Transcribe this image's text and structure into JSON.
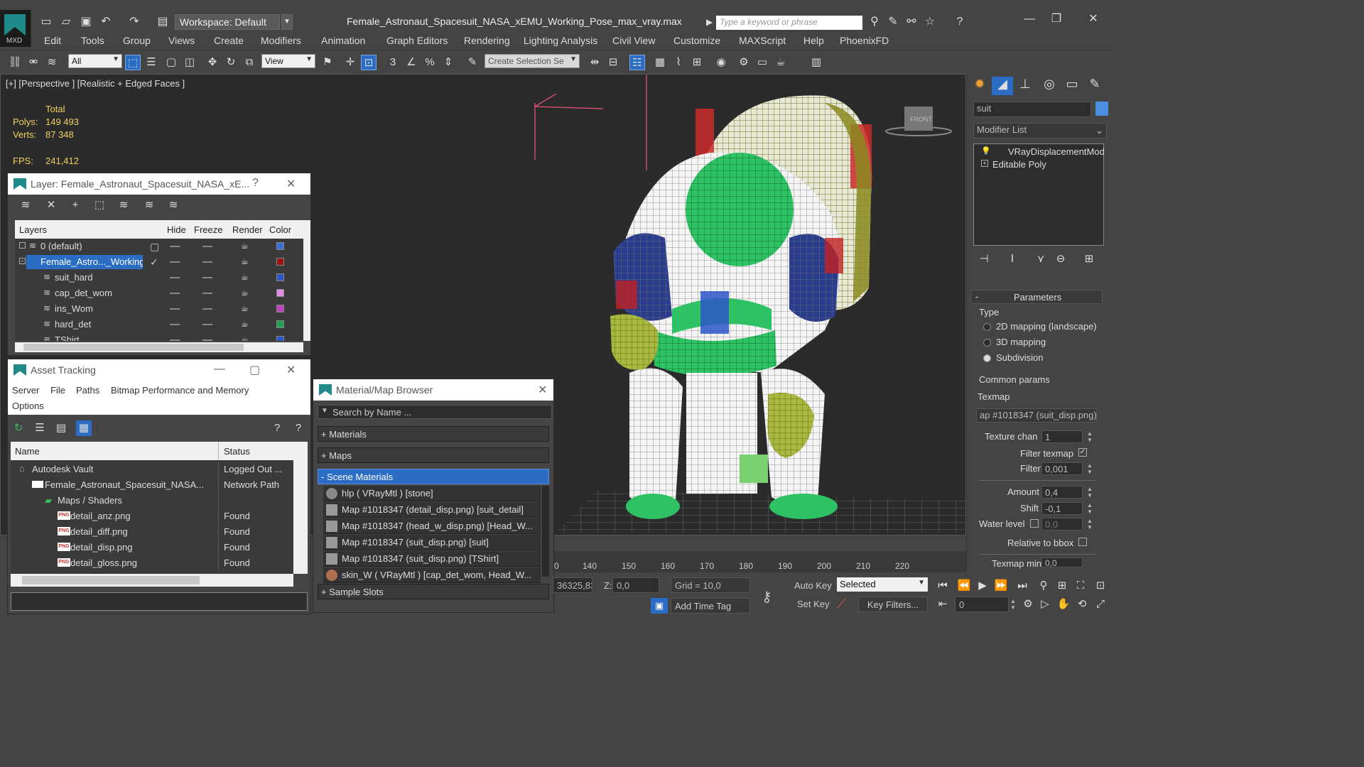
{
  "app": {
    "logo_text": "MXD",
    "workspace_label": "Workspace: Default",
    "doc_title": "Female_Astronaut_Spacesuit_NASA_xEMU_Working_Pose_max_vray.max",
    "search_placeholder": "Type a keyword or phrase"
  },
  "menu": [
    "Edit",
    "Tools",
    "Group",
    "Views",
    "Create",
    "Modifiers",
    "Animation",
    "Graph Editors",
    "Rendering",
    "Lighting Analysis",
    "Civil View",
    "Customize",
    "MAXScript",
    "Help",
    "PhoenixFD"
  ],
  "toolbar": {
    "filter_value": "All",
    "refcoord_value": "View",
    "selection_set_placeholder": "Create Selection Se"
  },
  "viewport": {
    "label": "[+] [Perspective ] [Realistic + Edged Faces ]",
    "stats_header": "Total",
    "polys_label": "Polys:",
    "polys_value": "149 493",
    "verts_label": "Verts:",
    "verts_value": "87 348",
    "fps_label": "FPS:",
    "fps_value": "241,412",
    "viewcube_label": "FRONT"
  },
  "layer_window": {
    "title": "Layer: Female_Astronaut_Spacesuit_NASA_xE...",
    "help": "?",
    "columns": [
      "Layers",
      "Hide",
      "Freeze",
      "Render",
      "Color"
    ],
    "rows": [
      {
        "name": "0 (default)",
        "color": "#3a6fd8",
        "checked": false,
        "selected": false,
        "indent": 0
      },
      {
        "name": "Female_Astro..._Working",
        "color": "#9b1010",
        "checked": true,
        "selected": true,
        "indent": 0
      },
      {
        "name": "suit_hard",
        "color": "#2a56c8",
        "checked": false,
        "selected": false,
        "indent": 1
      },
      {
        "name": "cap_det_wom",
        "color": "#e48be4",
        "checked": false,
        "selected": false,
        "indent": 1
      },
      {
        "name": "ins_Wom",
        "color": "#c040c0",
        "checked": false,
        "selected": false,
        "indent": 1
      },
      {
        "name": "hard_det",
        "color": "#1fa050",
        "checked": false,
        "selected": false,
        "indent": 1
      },
      {
        "name": "TShirt",
        "color": "#2a56c8",
        "checked": false,
        "selected": false,
        "indent": 1
      }
    ]
  },
  "asset_window": {
    "title": "Asset Tracking",
    "menu": [
      "Server",
      "File",
      "Paths",
      "Bitmap Performance and Memory",
      "Options"
    ],
    "col_name": "Name",
    "col_status": "Status",
    "rows": [
      {
        "name": "Autodesk Vault",
        "status": "Logged Out ...",
        "indent": 1,
        "icon": "vault"
      },
      {
        "name": "Female_Astronaut_Spacesuit_NASA...",
        "status": "Network Path",
        "indent": 2,
        "icon": "file"
      },
      {
        "name": "Maps / Shaders",
        "status": "",
        "indent": 3,
        "icon": "folder"
      },
      {
        "name": "detail_anz.png",
        "status": "Found",
        "indent": 4,
        "icon": "png"
      },
      {
        "name": "detail_diff.png",
        "status": "Found",
        "indent": 4,
        "icon": "png"
      },
      {
        "name": "detail_disp.png",
        "status": "Found",
        "indent": 4,
        "icon": "png"
      },
      {
        "name": "detail_gloss.png",
        "status": "Found",
        "indent": 4,
        "icon": "png"
      }
    ],
    "png_badge": "PNG"
  },
  "material_browser": {
    "title": "Material/Map Browser",
    "search_placeholder": "Search by Name ...",
    "groups": [
      "+ Materials",
      "+ Maps",
      "- Scene Materials"
    ],
    "items": [
      "hlp  ( VRayMtl ) [stone]",
      "Map #1018347 (detail_disp.png) [suit_detail]",
      "Map #1018347 (head_w_disp.png) [Head_W...",
      "Map #1018347 (suit_disp.png) [suit]",
      "Map #1018347 (suit_disp.png) [TShirt]",
      "skin_W  ( VRayMtl ) [cap_det_wom, Head_W..."
    ],
    "sample_slots": "+ Sample Slots"
  },
  "right_panel": {
    "name_field": "suit",
    "modifier_list": "Modifier List",
    "stack": [
      "VRayDisplacementMod",
      "Editable Poly"
    ],
    "rollout_title": "Parameters",
    "type_label": "Type",
    "type_options": [
      "2D mapping (landscape)",
      "3D mapping",
      "Subdivision"
    ],
    "type_selected": 2,
    "common_label": "Common params",
    "texmap_label": "Texmap",
    "texmap_value": "ap #1018347 (suit_disp.png)",
    "texture_chan_label": "Texture chan",
    "texture_chan_value": "1",
    "filter_texmap_label": "Filter texmap",
    "filter_blur_label": "Filter blur",
    "filter_blur_value": "0,001",
    "amount_label": "Amount",
    "amount_value": "0,4",
    "shift_label": "Shift",
    "shift_value": "-0,1",
    "water_level_label": "Water level",
    "water_level_value": "0,0",
    "relative_label": "Relative to bbox",
    "texmap_min_label": "Texmap min",
    "texmap_min_value": "0,0"
  },
  "timeline": {
    "ticks": [
      "0",
      "140",
      "150",
      "160",
      "170",
      "180",
      "190",
      "200",
      "210",
      "220"
    ]
  },
  "statusbar": {
    "x_value": "36325,83",
    "z_label": "Z:",
    "z_value": "0,0",
    "grid": "Grid = 10,0",
    "add_time_tag": "Add Time Tag",
    "auto_key": "Auto Key",
    "set_key": "Set Key",
    "selected": "Selected",
    "key_filters": "Key Filters...",
    "frame": "0"
  },
  "colors": {
    "accent": "#1f8a8a",
    "selection_blue": "#2b6cc4",
    "stat_yellow": "#f0d060"
  }
}
